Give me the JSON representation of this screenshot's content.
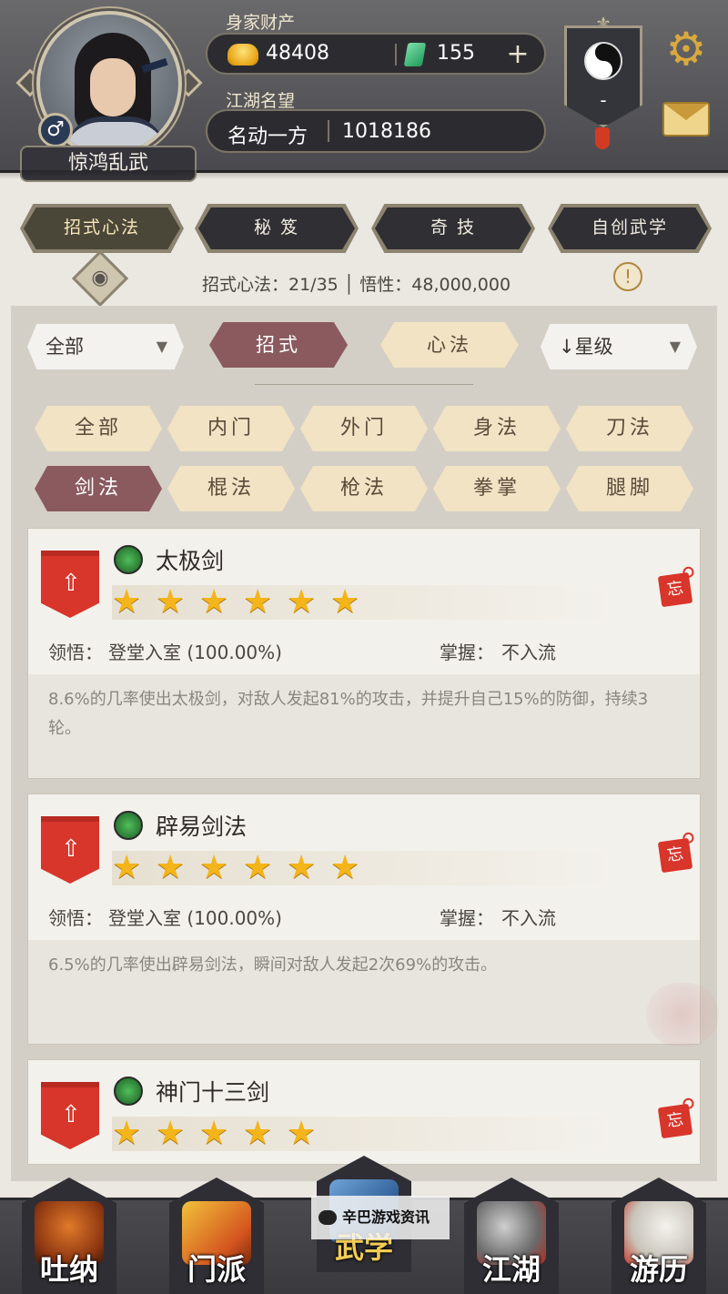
{
  "header": {
    "player_name": "惊鸿乱武",
    "gender_symbol": "♂",
    "wealth_label": "身家财产",
    "gold": "48408",
    "jade": "155",
    "plus_symbol": "+",
    "fame_label": "江湖名望",
    "fame_title": "名动一方",
    "fame_value": "1018186",
    "sect_value": "-"
  },
  "tabs": [
    {
      "label": "招式心法",
      "active": true
    },
    {
      "label": "秘 笈",
      "active": false
    },
    {
      "label": "奇 技",
      "active": false
    },
    {
      "label": "自创武学",
      "active": false
    }
  ],
  "stats": {
    "text": "招式心法：21/35 │ 悟性：48,000,000",
    "info_symbol": "!"
  },
  "filters_top": {
    "category_dropdown": "全部",
    "sort_dropdown": "↓星级",
    "type_a": "招式",
    "type_b": "心法"
  },
  "filters": [
    {
      "label": "全部",
      "active": false
    },
    {
      "label": "内门",
      "active": false
    },
    {
      "label": "外门",
      "active": false
    },
    {
      "label": "身法",
      "active": false
    },
    {
      "label": "刀法",
      "active": false
    },
    {
      "label": "剑法",
      "active": true
    },
    {
      "label": "棍法",
      "active": false
    },
    {
      "label": "枪法",
      "active": false
    },
    {
      "label": "拳掌",
      "active": false
    },
    {
      "label": "腿脚",
      "active": false
    }
  ],
  "skills": [
    {
      "name": "太极剑",
      "stars": 6,
      "comprehension_label": "领悟：",
      "comprehension_value": "登堂入室 (100.00%)",
      "mastery_label": "掌握：",
      "mastery_value": "不入流",
      "description": "8.6%的几率使出太极剑，对敌人发起81%的攻击，并提升自己15%的防御，持续3轮。",
      "forget_label": "忘"
    },
    {
      "name": "辟易剑法",
      "stars": 6,
      "comprehension_label": "领悟：",
      "comprehension_value": "登堂入室 (100.00%)",
      "mastery_label": "掌握：",
      "mastery_value": "不入流",
      "description": "6.5%的几率使出辟易剑法，瞬间对敌人发起2次69%的攻击。",
      "forget_label": "忘"
    },
    {
      "name": "神门十三剑",
      "stars": 5,
      "forget_label": "忘"
    }
  ],
  "bottom_nav": [
    {
      "label": "吐纳",
      "active": false
    },
    {
      "label": "门派",
      "active": false
    },
    {
      "label": "武学",
      "active": true
    },
    {
      "label": "江湖",
      "active": false
    },
    {
      "label": "游历",
      "active": false
    }
  ],
  "watermark": "辛巴游戏资讯"
}
